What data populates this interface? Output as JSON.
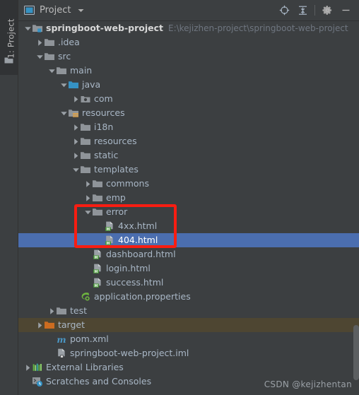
{
  "toolwindow": {
    "strip_label": "1: Project",
    "strip_icon": "folder-icon"
  },
  "header": {
    "icon": "project-view-icon",
    "title": "Project",
    "caret": "chevron-down-icon",
    "buttons": [
      {
        "name": "locate-icon",
        "tooltip": "Select Opened File"
      },
      {
        "name": "collapse-all-icon",
        "tooltip": "Collapse All"
      },
      {
        "name": "gear-icon",
        "tooltip": "Settings"
      },
      {
        "name": "minimize-icon",
        "tooltip": "Hide"
      }
    ]
  },
  "colors": {
    "background": "#3c3f41",
    "selection": "#4b6eaf",
    "highlight_row": "#4e4632",
    "annotation": "#f81d12",
    "text": "#a9b7c6",
    "path_text": "#6f7680",
    "folder": "#8f9499",
    "folder_source": "#3592c4",
    "folder_excluded": "#cc6c20",
    "html_badge": "#4e9a3f",
    "maven": "#4a96c4"
  },
  "tree": [
    {
      "id": "springboot-web-project",
      "label": "springboot-web-project",
      "path": "E:\\kejizhen-project\\springboot-web-project",
      "depth": 0,
      "arrow": "expanded",
      "icon": "module-icon",
      "bold": true
    },
    {
      "id": ".idea",
      "label": ".idea",
      "depth": 1,
      "arrow": "collapsed",
      "icon": "folder-icon"
    },
    {
      "id": "src",
      "label": "src",
      "depth": 1,
      "arrow": "expanded",
      "icon": "folder-icon"
    },
    {
      "id": "main",
      "label": "main",
      "depth": 2,
      "arrow": "expanded",
      "icon": "folder-icon"
    },
    {
      "id": "java",
      "label": "java",
      "depth": 3,
      "arrow": "expanded",
      "icon": "folder-source-icon"
    },
    {
      "id": "com",
      "label": "com",
      "depth": 4,
      "arrow": "collapsed",
      "icon": "package-icon"
    },
    {
      "id": "resources-root",
      "label": "resources",
      "depth": 3,
      "arrow": "expanded",
      "icon": "folder-resource-icon"
    },
    {
      "id": "i18n",
      "label": "i18n",
      "depth": 4,
      "arrow": "collapsed",
      "icon": "folder-icon"
    },
    {
      "id": "resources",
      "label": "resources",
      "depth": 4,
      "arrow": "collapsed",
      "icon": "folder-icon"
    },
    {
      "id": "static",
      "label": "static",
      "depth": 4,
      "arrow": "collapsed",
      "icon": "folder-icon"
    },
    {
      "id": "templates",
      "label": "templates",
      "depth": 4,
      "arrow": "expanded",
      "icon": "folder-icon"
    },
    {
      "id": "commons",
      "label": "commons",
      "depth": 5,
      "arrow": "collapsed",
      "icon": "folder-icon"
    },
    {
      "id": "emp",
      "label": "emp",
      "depth": 5,
      "arrow": "collapsed",
      "icon": "folder-icon"
    },
    {
      "id": "error",
      "label": "error",
      "depth": 5,
      "arrow": "expanded",
      "icon": "folder-icon"
    },
    {
      "id": "4xx.html",
      "label": "4xx.html",
      "depth": 6,
      "arrow": "none",
      "icon": "html-file-icon"
    },
    {
      "id": "404.html",
      "label": "404.html",
      "depth": 6,
      "arrow": "none",
      "icon": "html-file-icon",
      "selected": true
    },
    {
      "id": "dashboard.html",
      "label": "dashboard.html",
      "depth": 5,
      "arrow": "none",
      "icon": "html-file-icon"
    },
    {
      "id": "login.html",
      "label": "login.html",
      "depth": 5,
      "arrow": "none",
      "icon": "html-file-icon"
    },
    {
      "id": "success.html",
      "label": "success.html",
      "depth": 5,
      "arrow": "none",
      "icon": "html-file-icon"
    },
    {
      "id": "application.properties",
      "label": "application.properties",
      "depth": 4,
      "arrow": "none",
      "icon": "spring-properties-icon"
    },
    {
      "id": "test",
      "label": "test",
      "depth": 2,
      "arrow": "collapsed",
      "icon": "folder-icon"
    },
    {
      "id": "target",
      "label": "target",
      "depth": 1,
      "arrow": "collapsed",
      "icon": "folder-excluded-icon",
      "highlighted": true
    },
    {
      "id": "pom.xml",
      "label": "pom.xml",
      "depth": 2,
      "arrow": "none",
      "icon": "maven-icon"
    },
    {
      "id": "springboot-web-project.iml",
      "label": "springboot-web-project.iml",
      "depth": 2,
      "arrow": "none",
      "icon": "iml-file-icon"
    },
    {
      "id": "External Libraries",
      "label": "External Libraries",
      "depth": 0,
      "arrow": "collapsed",
      "icon": "libraries-icon"
    },
    {
      "id": "Scratches and Consoles",
      "label": "Scratches and Consoles",
      "depth": 0,
      "arrow": "none",
      "icon": "scratches-icon"
    }
  ],
  "annotation": {
    "type": "red-rectangle",
    "covers": [
      "error",
      "4xx.html",
      "404.html"
    ]
  },
  "watermark": "CSDN @kejizhentan"
}
